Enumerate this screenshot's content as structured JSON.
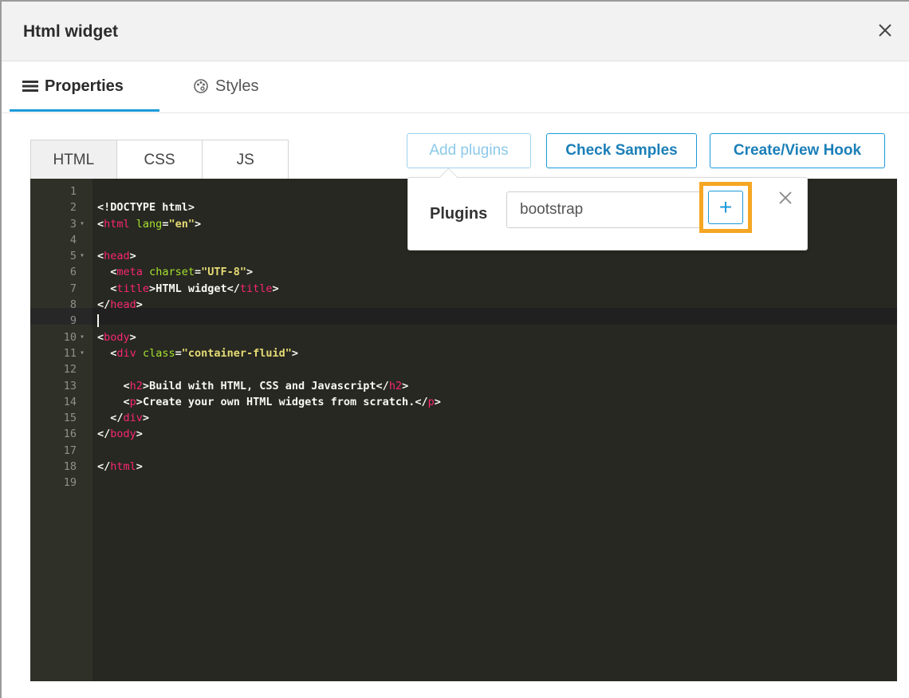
{
  "dialog": {
    "title": "Html widget",
    "close_icon": "close-icon"
  },
  "tabs": [
    {
      "label": "Properties",
      "icon": "list-icon",
      "active": true
    },
    {
      "label": "Styles",
      "icon": "palette-icon",
      "active": false
    }
  ],
  "editor_tabs": [
    {
      "label": "HTML",
      "active": true
    },
    {
      "label": "CSS",
      "active": false
    },
    {
      "label": "JS",
      "active": false
    }
  ],
  "toolbar": {
    "add_plugins_label": "Add plugins",
    "check_samples_label": "Check Samples",
    "create_hook_label": "Create/View Hook"
  },
  "plugins_popover": {
    "label": "Plugins",
    "input_value": "bootstrap",
    "add_symbol": "+",
    "highlight_color": "#f5a623"
  },
  "code": {
    "active_line": 9,
    "lines": [
      {
        "n": "1",
        "fold": false,
        "text": ""
      },
      {
        "n": "2",
        "fold": false,
        "text": "<!DOCTYPE html>"
      },
      {
        "n": "3",
        "fold": true,
        "text": "<html lang=\"en\">"
      },
      {
        "n": "4",
        "fold": false,
        "text": ""
      },
      {
        "n": "5",
        "fold": true,
        "text": "<head>"
      },
      {
        "n": "6",
        "fold": false,
        "text": "  <meta charset=\"UTF-8\">"
      },
      {
        "n": "7",
        "fold": false,
        "text": "  <title>HTML widget</title>"
      },
      {
        "n": "8",
        "fold": false,
        "text": "</head>"
      },
      {
        "n": "9",
        "fold": false,
        "text": ""
      },
      {
        "n": "10",
        "fold": true,
        "text": "<body>"
      },
      {
        "n": "11",
        "fold": true,
        "text": "  <div class=\"container-fluid\">"
      },
      {
        "n": "12",
        "fold": false,
        "text": ""
      },
      {
        "n": "13",
        "fold": false,
        "text": "    <h2>Build with HTML, CSS and Javascript</h2>"
      },
      {
        "n": "14",
        "fold": false,
        "text": "    <p>Create your own HTML widgets from scratch.</p>"
      },
      {
        "n": "15",
        "fold": false,
        "text": "  </div>"
      },
      {
        "n": "16",
        "fold": false,
        "text": "</body>"
      },
      {
        "n": "17",
        "fold": false,
        "text": ""
      },
      {
        "n": "18",
        "fold": false,
        "text": "</html>"
      },
      {
        "n": "19",
        "fold": false,
        "text": ""
      }
    ]
  },
  "colors": {
    "accent": "#1b9ad8",
    "editor_bg": "#272822",
    "tag": "#f92672",
    "attr": "#a6e22e",
    "string": "#e6db74"
  }
}
